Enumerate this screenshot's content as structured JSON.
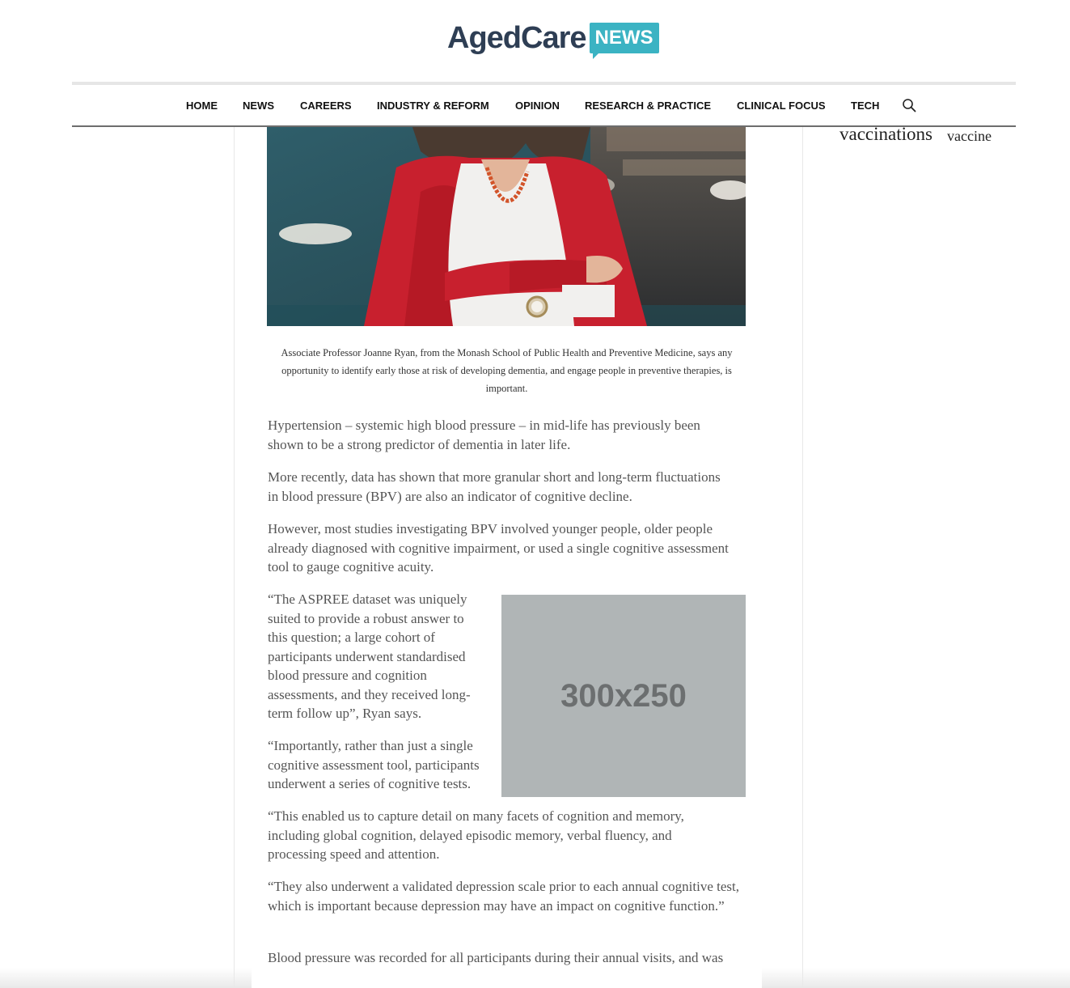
{
  "logo": {
    "part1": "AgedCare",
    "part2": "NEWS"
  },
  "nav": {
    "items": [
      "HOME",
      "NEWS",
      "CAREERS",
      "INDUSTRY & REFORM",
      "OPINION",
      "RESEARCH & PRACTICE",
      "CLINICAL FOCUS",
      "TECH"
    ],
    "search_icon": "search-icon"
  },
  "sidebar": {
    "tags": [
      "vaccinations",
      "vaccine"
    ]
  },
  "article": {
    "caption": "Associate Professor Joanne Ryan, from the Monash School of Public Health and Preventive Medicine, says any opportunity to identify early those at risk of developing dementia, and engage people in preventive therapies, is important.",
    "paragraphs": [
      "Hypertension – systemic high blood pressure – in mid-life has previously been shown to be a strong predictor of dementia in later life.",
      "More recently, data has shown that more granular short and long-term fluctuations in blood pressure (BPV) are also an indicator of cognitive decline.",
      "However, most studies investigating BPV involved younger people, older people already diagnosed with cognitive impairment, or used a single cognitive assessment tool to gauge cognitive acuity.",
      "“The ASPREE dataset was uniquely suited to provide a robust answer to this question; a large cohort of participants underwent standardised blood pressure and cognition assessments, and they received long-term follow up”, Ryan says.",
      "“Importantly, rather than just a single cognitive assessment tool, participants underwent a series of cognitive tests.",
      "“This enabled us to capture detail on many facets of cognition and memory, including global cognition, delayed episodic memory, verbal fluency, and processing speed and attention.",
      "“They also underwent a validated depression scale prior to each annual cognitive test, which is important because depression may have an impact on cognitive function.”",
      "Blood pressure was recorded for all participants during their annual visits, and was"
    ]
  },
  "ad": {
    "label": "300x250"
  },
  "colors": {
    "accent": "#3bb3c3",
    "logo_dark": "#2e3e54",
    "ad_bg": "#b0b5b6"
  }
}
